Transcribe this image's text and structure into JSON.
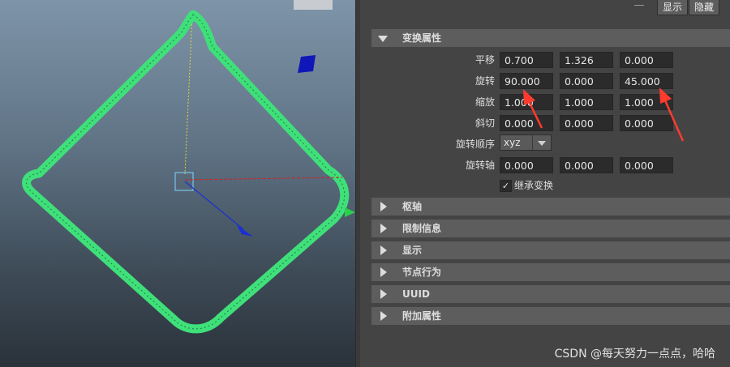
{
  "header": {
    "show_button": "显示",
    "hide_button": "隐藏"
  },
  "transform": {
    "title": "变换属性",
    "rows": [
      {
        "label": "平移",
        "values": [
          "0.700",
          "1.326",
          "0.000"
        ]
      },
      {
        "label": "旋转",
        "values": [
          "90.000",
          "0.000",
          "45.000"
        ]
      },
      {
        "label": "缩放",
        "values": [
          "1.000",
          "1.000",
          "1.000"
        ]
      },
      {
        "label": "斜切",
        "values": [
          "0.000",
          "0.000",
          "0.000"
        ]
      }
    ],
    "rotate_order": {
      "label": "旋转顺序",
      "value": "xyz"
    },
    "rotate_axis": {
      "label": "旋转轴",
      "values": [
        "0.000",
        "0.000",
        "0.000"
      ]
    },
    "inherit": {
      "label": "继承变换",
      "checked": true
    }
  },
  "sections": [
    "枢轴",
    "限制信息",
    "显示",
    "节点行为",
    "UUID",
    "附加属性"
  ],
  "watermark": "CSDN @每天努力一点点，哈哈",
  "colors": {
    "wire": "#3fe07a",
    "annotation_arrow": "#ff3b2f",
    "panel_bg": "#444444",
    "section_bg": "#5d5d5d",
    "field_bg": "#2b2b2b"
  }
}
